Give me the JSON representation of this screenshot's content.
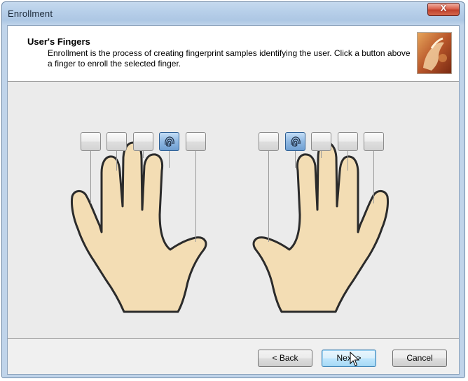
{
  "window": {
    "title": "Enrollment",
    "close_label": "X"
  },
  "header": {
    "title": "User's Fingers",
    "description": "Enrollment is the process of creating fingerprint samples identifying the user. Click a button above a finger to enroll the selected finger."
  },
  "hands": {
    "left": {
      "fingers": [
        {
          "finger": "little",
          "enrolled": false
        },
        {
          "finger": "ring",
          "enrolled": false
        },
        {
          "finger": "middle",
          "enrolled": false
        },
        {
          "finger": "index",
          "enrolled": true
        },
        {
          "finger": "thumb",
          "enrolled": false
        }
      ]
    },
    "right": {
      "fingers": [
        {
          "finger": "thumb",
          "enrolled": false
        },
        {
          "finger": "index",
          "enrolled": true
        },
        {
          "finger": "middle",
          "enrolled": false
        },
        {
          "finger": "ring",
          "enrolled": false
        },
        {
          "finger": "little",
          "enrolled": false
        }
      ]
    }
  },
  "buttons": {
    "back": "< Back",
    "next": "Next >",
    "cancel": "Cancel"
  },
  "colors": {
    "skin": "#f3ddb4",
    "skin_outline": "#2b2b2b",
    "enrolled_button": "#8fb8e2",
    "close_button": "#c84a35"
  },
  "icons": [
    "fingerprint-icon",
    "close-icon",
    "mouse-cursor-icon"
  ]
}
